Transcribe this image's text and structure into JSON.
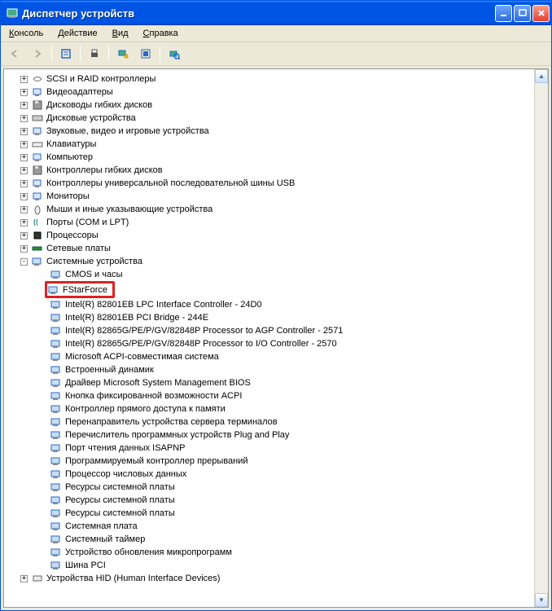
{
  "title": "Диспетчер устройств",
  "menus": {
    "console": "Консоль",
    "action": "Действие",
    "view": "Вид",
    "help": "Справка"
  },
  "categories": [
    "SCSI и RAID контроллеры",
    "Видеоадаптеры",
    "Дисководы гибких дисков",
    "Дисковые устройства",
    "Звуковые, видео и игровые устройства",
    "Клавиатуры",
    "Компьютер",
    "Контроллеры гибких дисков",
    "Контроллеры универсальной последовательной шины USB",
    "Мониторы",
    "Мыши и иные указывающие устройства",
    "Порты (COM и LPT)",
    "Процессоры",
    "Сетевые платы"
  ],
  "system_category": "Системные устройства",
  "system_devices": [
    "CMOS и часы",
    "FStarForce",
    "Intel(R) 82801EB LPC Interface Controller - 24D0",
    "Intel(R) 82801EB PCI Bridge - 244E",
    "Intel(R) 82865G/PE/P/GV/82848P Processor to AGP Controller - 2571",
    "Intel(R) 82865G/PE/P/GV/82848P Processor to I/O Controller - 2570",
    "Microsoft ACPI-совместимая система",
    "Встроенный динамик",
    "Драйвер Microsoft System Management BIOS",
    "Кнопка фиксированной возможности ACPI",
    "Контроллер прямого доступа к памяти",
    "Перенаправитель устройства сервера терминалов",
    "Перечислитель программных устройств Plug and Play",
    "Порт чтения данных ISAPNP",
    "Программируемый контроллер прерываний",
    "Процессор числовых данных",
    "Ресурсы системной платы",
    "Ресурсы системной платы",
    "Ресурсы системной платы",
    "Системная плата",
    "Системный таймер",
    "Устройство обновления микропрограмм",
    "Шина PCI"
  ],
  "highlighted_index": 1,
  "last_category": "Устройства HID (Human Interface Devices)"
}
